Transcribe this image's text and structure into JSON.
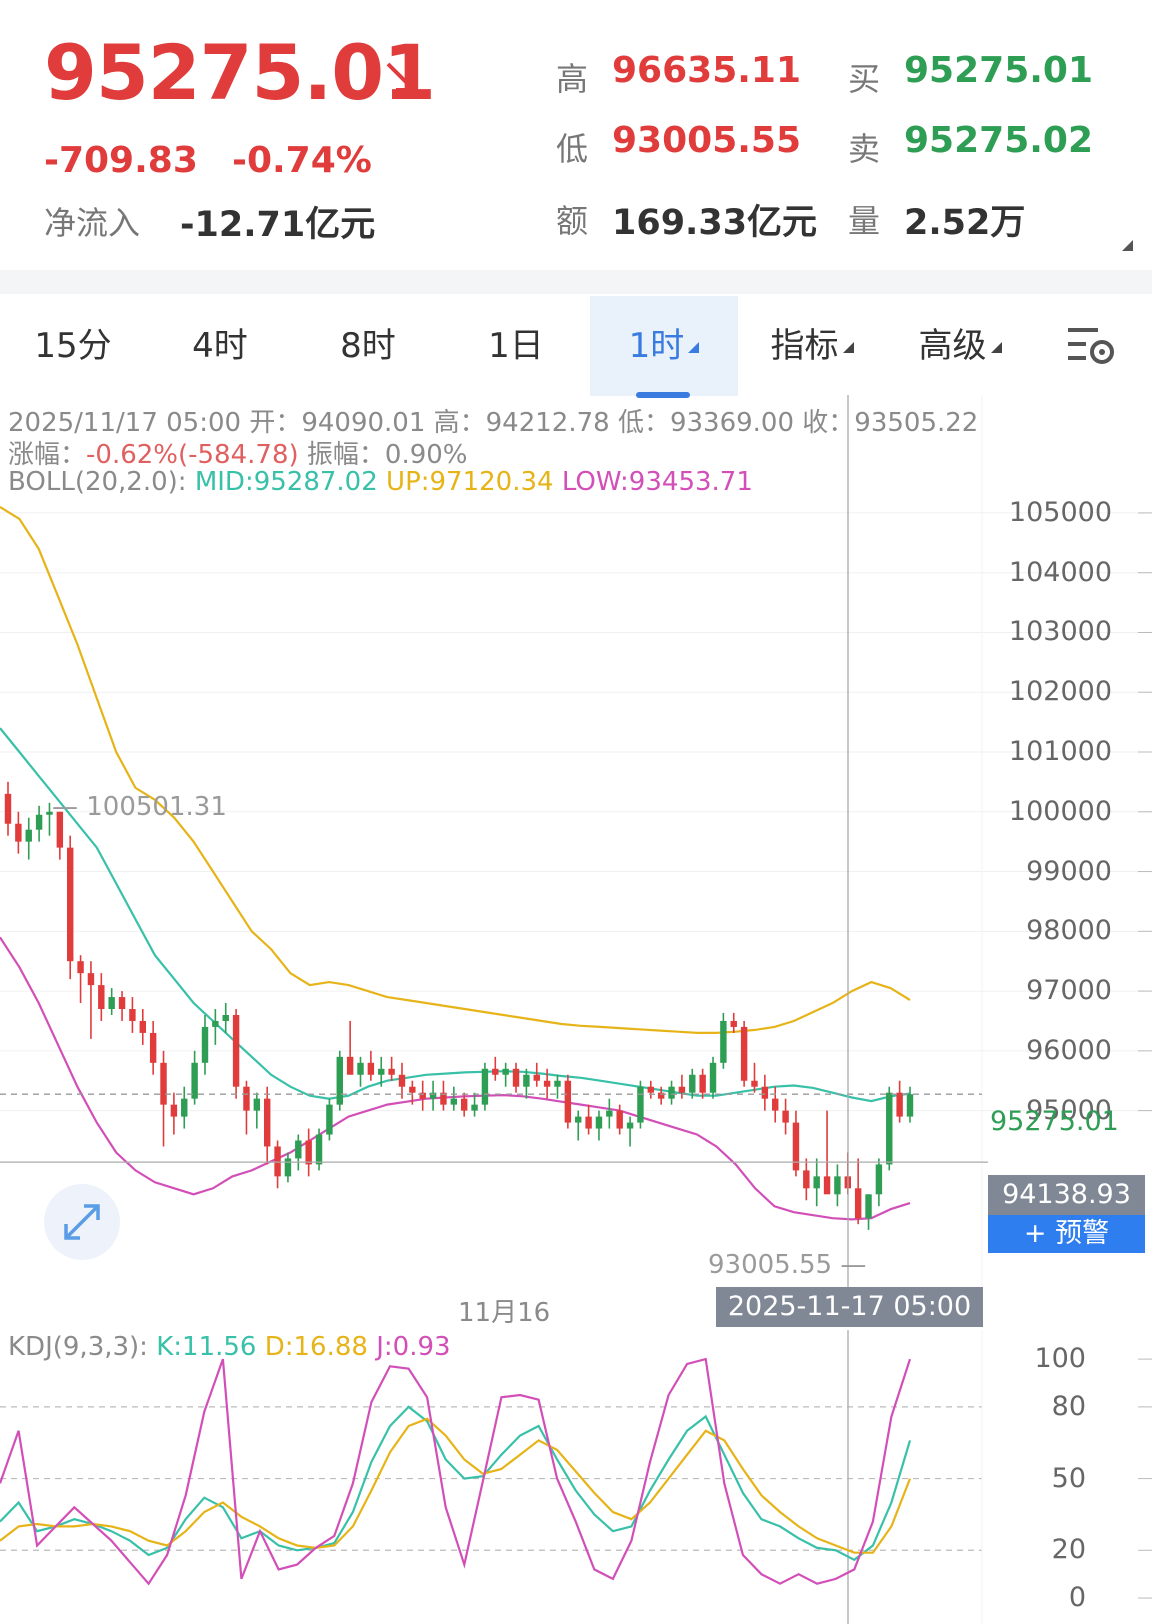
{
  "header": {
    "price": "95275.01",
    "change": "-709.83",
    "change_pct": "-0.74%",
    "netflow_label": "净流入",
    "netflow_value": "-12.71亿元",
    "high_label": "高",
    "high_value": "96635.11",
    "low_label": "低",
    "low_value": "93005.55",
    "amount_label": "额",
    "amount_value": "169.33亿元",
    "bid_label": "买",
    "bid_value": "95275.01",
    "ask_label": "卖",
    "ask_value": "95275.02",
    "volume_label": "量",
    "volume_value": "2.52万"
  },
  "tabs": {
    "t15m": "15分",
    "t4h": "4时",
    "t8h": "8时",
    "t1d": "1日",
    "t1h": "1时",
    "indicator": "指标",
    "advanced": "高级"
  },
  "info": {
    "line1": "2025/11/17 05:00 开：94090.01 高：94212.78 低：93369.00 收：93505.22",
    "line2_label": "涨幅：",
    "line2_change": "-0.62%(-584.78)",
    "line2_amp": "振幅：0.90%",
    "boll_label": "BOLL(20,2.0):",
    "boll_mid": "MID:95287.02",
    "boll_up": "UP:97120.34",
    "boll_low": "LOW:93453.71",
    "kdj_label": "KDJ(9,3,3):",
    "kdj_k": "K:11.56",
    "kdj_d": "D:16.88",
    "kdj_j": "J:0.93"
  },
  "labels": {
    "current_price": "95275.01",
    "crosshair_price": "94138.93",
    "alert_button": "+ 预警",
    "crosshair_date": "2025-11-17 05:00",
    "day_marker": "11月16",
    "max_marker": "100501.31",
    "min_marker": "93005.55"
  },
  "colors": {
    "up": "#e03c3c",
    "down": "#2f9e55",
    "mid": "#38c0a8",
    "upper": "#e6b418",
    "lower": "#d24fb8",
    "accent": "#3a7be0"
  },
  "icons": {
    "trend": "arrow-down-right-icon",
    "settings": "chart-settings-icon",
    "expand": "expand-icon"
  },
  "chart_data": [
    {
      "type": "candlestick",
      "title": "BOLL(20,2.0)",
      "y_ticks": [
        105000,
        104000,
        103000,
        102000,
        101000,
        100000,
        99000,
        98000,
        97000,
        96000,
        95000
      ],
      "ylim": [
        92300,
        105300
      ],
      "candles": [
        [
          100300,
          100501,
          99600,
          99800
        ],
        [
          99800,
          100000,
          99300,
          99500
        ],
        [
          99500,
          99900,
          99200,
          99700
        ],
        [
          99700,
          100100,
          99500,
          99950
        ],
        [
          99950,
          100150,
          99600,
          100000
        ],
        [
          100000,
          100000,
          99200,
          99400
        ],
        [
          99400,
          99600,
          97200,
          97500
        ],
        [
          97500,
          97600,
          96800,
          97300
        ],
        [
          97300,
          97500,
          96200,
          97100
        ],
        [
          97100,
          97300,
          96500,
          96700
        ],
        [
          96700,
          97050,
          96600,
          96900
        ],
        [
          96900,
          97000,
          96500,
          96700
        ],
        [
          96700,
          96900,
          96300,
          96500
        ],
        [
          96500,
          96700,
          96100,
          96300
        ],
        [
          96300,
          96500,
          95600,
          95800
        ],
        [
          95800,
          96000,
          94400,
          95100
        ],
        [
          95100,
          95300,
          94600,
          94900
        ],
        [
          94900,
          95400,
          94700,
          95200
        ],
        [
          95200,
          96000,
          95100,
          95800
        ],
        [
          95800,
          96600,
          95600,
          96400
        ],
        [
          96400,
          96700,
          96100,
          96500
        ],
        [
          96500,
          96800,
          96300,
          96600
        ],
        [
          96600,
          96700,
          95200,
          95400
        ],
        [
          95400,
          95500,
          94600,
          95000
        ],
        [
          95000,
          95300,
          94700,
          95200
        ],
        [
          95200,
          95400,
          94100,
          94400
        ],
        [
          94400,
          94500,
          93700,
          93900
        ],
        [
          93900,
          94300,
          93800,
          94200
        ],
        [
          94200,
          94600,
          94000,
          94500
        ],
        [
          94500,
          94700,
          93900,
          94100
        ],
        [
          94100,
          94700,
          94000,
          94600
        ],
        [
          94600,
          95200,
          94500,
          95100
        ],
        [
          95100,
          96000,
          95000,
          95900
        ],
        [
          95900,
          96500,
          95700,
          95600
        ],
        [
          95600,
          95900,
          95400,
          95800
        ],
        [
          95800,
          96000,
          95500,
          95600
        ],
        [
          95600,
          95900,
          95400,
          95700
        ],
        [
          95700,
          95900,
          95500,
          95600
        ],
        [
          95600,
          95800,
          95200,
          95400
        ],
        [
          95400,
          95500,
          95100,
          95300
        ],
        [
          95300,
          95500,
          95000,
          95200
        ],
        [
          95200,
          95500,
          95000,
          95300
        ],
        [
          95300,
          95500,
          95000,
          95100
        ],
        [
          95100,
          95400,
          95000,
          95200
        ],
        [
          95200,
          95300,
          94900,
          95000
        ],
        [
          95000,
          95300,
          94900,
          95100
        ],
        [
          95100,
          95800,
          95000,
          95700
        ],
        [
          95700,
          95900,
          95500,
          95600
        ],
        [
          95600,
          95800,
          95400,
          95700
        ],
        [
          95700,
          95800,
          95300,
          95400
        ],
        [
          95400,
          95700,
          95200,
          95600
        ],
        [
          95600,
          95800,
          95400,
          95500
        ],
        [
          95500,
          95700,
          95200,
          95400
        ],
        [
          95400,
          95600,
          95200,
          95500
        ],
        [
          95500,
          95600,
          94700,
          94800
        ],
        [
          94800,
          95000,
          94500,
          94900
        ],
        [
          94900,
          95100,
          94600,
          94700
        ],
        [
          94700,
          95000,
          94500,
          94900
        ],
        [
          94900,
          95200,
          94700,
          95000
        ],
        [
          95000,
          95100,
          94600,
          94700
        ],
        [
          94700,
          94900,
          94400,
          94800
        ],
        [
          94800,
          95500,
          94700,
          95400
        ],
        [
          95400,
          95500,
          95200,
          95300
        ],
        [
          95300,
          95400,
          95100,
          95200
        ],
        [
          95200,
          95500,
          95100,
          95400
        ],
        [
          95400,
          95600,
          95200,
          95300
        ],
        [
          95300,
          95700,
          95200,
          95600
        ],
        [
          95600,
          95700,
          95200,
          95300
        ],
        [
          95300,
          95900,
          95200,
          95800
        ],
        [
          95800,
          96635,
          95700,
          96500
        ],
        [
          96500,
          96635,
          96300,
          96400
        ],
        [
          96400,
          96500,
          95400,
          95500
        ],
        [
          95500,
          95800,
          95300,
          95400
        ],
        [
          95400,
          95600,
          95000,
          95200
        ],
        [
          95200,
          95400,
          94800,
          95000
        ],
        [
          95000,
          95200,
          94600,
          94800
        ],
        [
          94800,
          95000,
          93900,
          94000
        ],
        [
          94000,
          94200,
          93500,
          93700
        ],
        [
          93700,
          94200,
          93400,
          93900
        ],
        [
          93900,
          95000,
          93700,
          93600
        ],
        [
          93600,
          94100,
          93400,
          93900
        ],
        [
          93900,
          94300,
          93600,
          93700
        ],
        [
          93700,
          94200,
          93100,
          93200
        ],
        [
          93200,
          93600,
          93005,
          93600
        ],
        [
          93600,
          94200,
          93400,
          94100
        ],
        [
          94100,
          95400,
          94000,
          95300
        ],
        [
          95300,
          95500,
          94800,
          94900
        ],
        [
          94900,
          95400,
          94800,
          95275
        ]
      ],
      "boll_up": [
        105100,
        104900,
        104400,
        103600,
        102800,
        101900,
        101000,
        100400,
        100200,
        99900,
        99500,
        99000,
        98500,
        98000,
        97700,
        97300,
        97100,
        97150,
        97100,
        97000,
        96900,
        96850,
        96800,
        96750,
        96700,
        96650,
        96600,
        96550,
        96500,
        96450,
        96420,
        96400,
        96380,
        96360,
        96340,
        96320,
        96300,
        96300,
        96320,
        96350,
        96400,
        96500,
        96650,
        96800,
        97000,
        97150,
        97050,
        96850
      ],
      "boll_mid": [
        101400,
        101000,
        100600,
        100200,
        99800,
        99400,
        98800,
        98200,
        97600,
        97200,
        96800,
        96500,
        96200,
        95900,
        95600,
        95400,
        95250,
        95200,
        95250,
        95400,
        95500,
        95550,
        95600,
        95620,
        95640,
        95650,
        95660,
        95650,
        95620,
        95580,
        95550,
        95500,
        95450,
        95400,
        95350,
        95300,
        95250,
        95250,
        95300,
        95350,
        95400,
        95420,
        95380,
        95300,
        95220,
        95160,
        95240,
        95287
      ],
      "boll_low": [
        97900,
        97400,
        96800,
        96100,
        95400,
        94800,
        94300,
        94000,
        93800,
        93700,
        93600,
        93700,
        93900,
        94000,
        94150,
        94300,
        94500,
        94700,
        94900,
        95000,
        95100,
        95150,
        95200,
        95220,
        95240,
        95250,
        95260,
        95240,
        95200,
        95150,
        95100,
        95050,
        95000,
        94900,
        94800,
        94700,
        94600,
        94400,
        94100,
        93700,
        93400,
        93300,
        93250,
        93200,
        93180,
        93200,
        93350,
        93453
      ]
    },
    {
      "type": "line",
      "title": "KDJ(9,3,3)",
      "y_ticks": [
        100,
        80,
        50,
        20,
        0
      ],
      "ylim": [
        -5,
        108
      ],
      "series": [
        {
          "name": "K",
          "values": [
            32,
            40,
            28,
            30,
            33,
            31,
            28,
            24,
            18,
            21,
            33,
            42,
            38,
            25,
            28,
            22,
            20,
            21,
            23,
            36,
            57,
            72,
            80,
            74,
            58,
            50,
            51,
            60,
            68,
            72,
            58,
            45,
            35,
            28,
            30,
            45,
            58,
            70,
            76,
            60,
            44,
            33,
            30,
            25,
            21,
            20,
            16,
            22,
            40,
            66
          ]
        },
        {
          "name": "D",
          "values": [
            24,
            30,
            31,
            30,
            30,
            31,
            30,
            28,
            24,
            22,
            28,
            36,
            40,
            34,
            30,
            25,
            22,
            21,
            22,
            30,
            45,
            61,
            72,
            75,
            68,
            58,
            52,
            54,
            60,
            66,
            62,
            53,
            44,
            36,
            33,
            40,
            50,
            60,
            70,
            66,
            54,
            43,
            36,
            30,
            25,
            22,
            19,
            19,
            30,
            50
          ]
        },
        {
          "name": "J",
          "values": [
            48,
            70,
            22,
            30,
            38,
            31,
            24,
            15,
            6,
            18,
            43,
            78,
            100,
            8,
            28,
            12,
            14,
            21,
            26,
            48,
            82,
            97,
            96,
            84,
            38,
            14,
            49,
            84,
            85,
            83,
            50,
            32,
            12,
            8,
            24,
            57,
            85,
            98,
            100,
            48,
            18,
            10,
            6,
            10,
            6,
            8,
            12,
            32,
            76,
            100
          ]
        }
      ]
    }
  ]
}
